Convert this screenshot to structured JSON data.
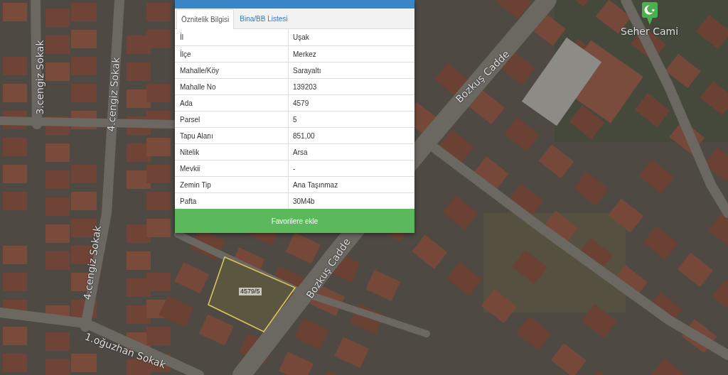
{
  "panel": {
    "tabs": [
      {
        "label": "Öznitelik Bilgisi",
        "selected": true
      },
      {
        "label": "Bina/BB Listesi",
        "selected": false
      }
    ],
    "attributes": [
      {
        "name": "İl",
        "value": "Uşak"
      },
      {
        "name": "İlçe",
        "value": "Merkez"
      },
      {
        "name": "Mahalle/Köy",
        "value": "Sarayaltı"
      },
      {
        "name": "Mahalle No",
        "value": "139203"
      },
      {
        "name": "Ada",
        "value": "4579"
      },
      {
        "name": "Parsel",
        "value": "5"
      },
      {
        "name": "Tapu Alanı",
        "value": "851,00"
      },
      {
        "name": "Nitelik",
        "value": "Arsa"
      },
      {
        "name": "Mevkii",
        "value": "-"
      },
      {
        "name": "Zemin Tip",
        "value": "Ana Taşınmaz"
      },
      {
        "name": "Pafta",
        "value": "30M4b"
      }
    ],
    "button": "Favorilere ekle"
  },
  "map": {
    "street_labels": [
      "3.cengiz Sokak",
      "Bozkuş Cadde",
      "4.cengiz Sokak",
      "4.cengiz Sokak",
      "Bozkuş Cadde",
      "1.oğuzhan Sokak"
    ],
    "place": {
      "name": "Seher Cami"
    },
    "parcel": {
      "label": "4579/5"
    }
  }
}
